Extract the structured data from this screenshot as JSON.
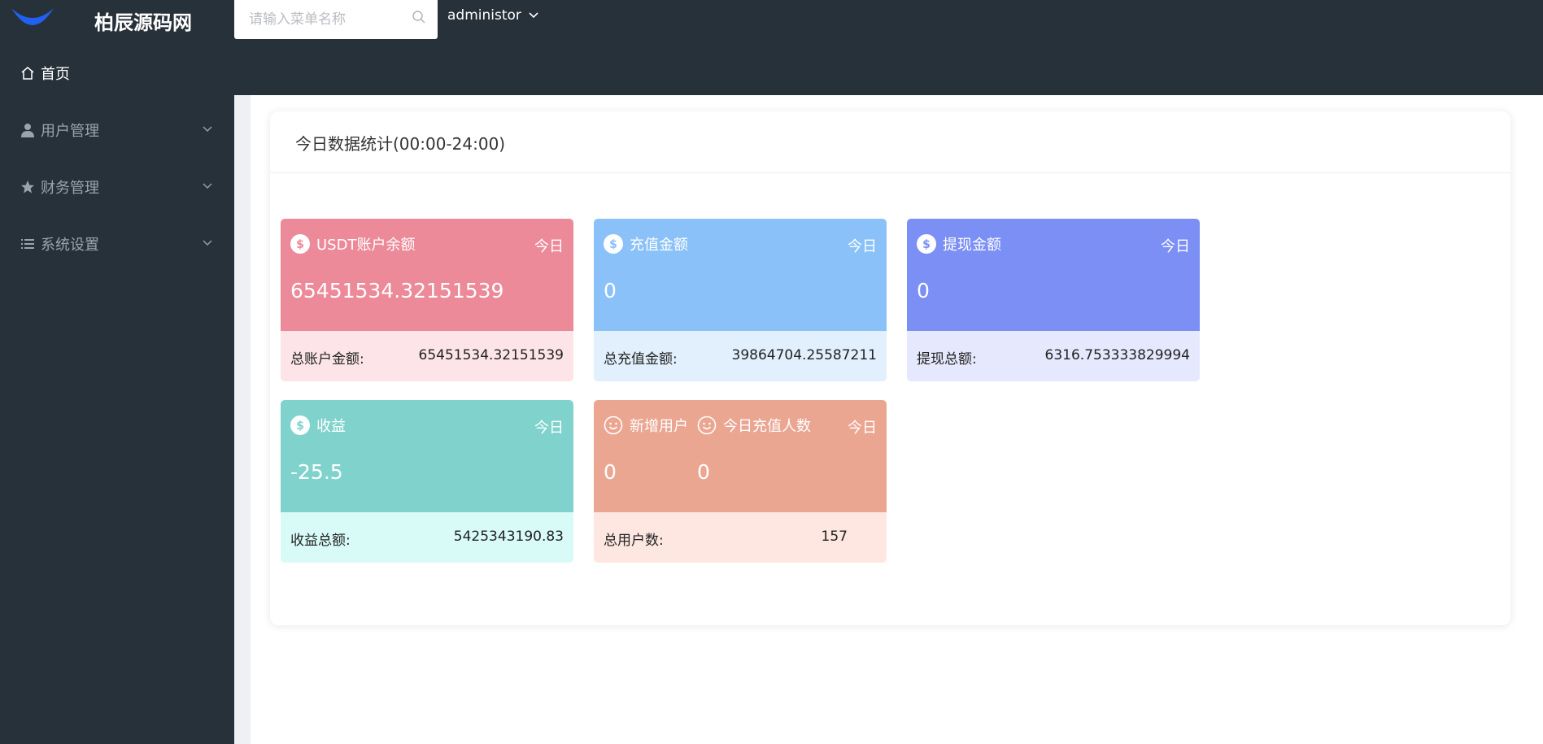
{
  "header": {
    "brand": "柏辰源码网",
    "search_placeholder": "请输入菜单名称",
    "username": "administor"
  },
  "sidebar": {
    "items": [
      {
        "label": "首页",
        "icon": "home-icon",
        "active": true
      },
      {
        "label": "用户管理",
        "icon": "user-icon",
        "expandable": true
      },
      {
        "label": "财务管理",
        "icon": "star-icon",
        "expandable": true
      },
      {
        "label": "系统设置",
        "icon": "list-icon",
        "expandable": true
      }
    ]
  },
  "panel": {
    "title": "今日数据统计(00:00-24:00)"
  },
  "cards": [
    {
      "title": "USDT账户余额",
      "badge": "今日",
      "value": "65451534.32151539",
      "footer_label": "总账户金额:",
      "footer_value": "65451534.32151539",
      "top_color": "#ec8a99",
      "bottom_color": "#fde4e8",
      "icon": "dollar-circle-icon"
    },
    {
      "title": "充值金额",
      "badge": "今日",
      "value": "0",
      "footer_label": "总充值金额:",
      "footer_value": "39864704.25587211",
      "top_color": "#89c1f8",
      "bottom_color": "#e2f0fd",
      "icon": "dollar-circle-icon"
    },
    {
      "title": "提现金额",
      "badge": "今日",
      "value": "0",
      "footer_label": "提现总额:",
      "footer_value": "6316.753333829994",
      "top_color": "#7b8ff5",
      "bottom_color": "#e6e8fd",
      "icon": "dollar-circle-icon"
    },
    {
      "title": "收益",
      "badge": "今日",
      "value": "-25.5",
      "footer_label": "收益总额:",
      "footer_value": "5425343190.83",
      "top_color": "#80d3cd",
      "bottom_color": "#d9fbf8",
      "icon": "dollar-circle-icon"
    },
    {
      "title": "新增用户",
      "title2": "今日充值人数",
      "badge": "今日",
      "value": "0",
      "value2": "0",
      "footer_label": "总用户数:",
      "footer_value": "157",
      "top_color": "#eba692",
      "bottom_color": "#fde7e0",
      "icon": "smile-icon"
    }
  ]
}
